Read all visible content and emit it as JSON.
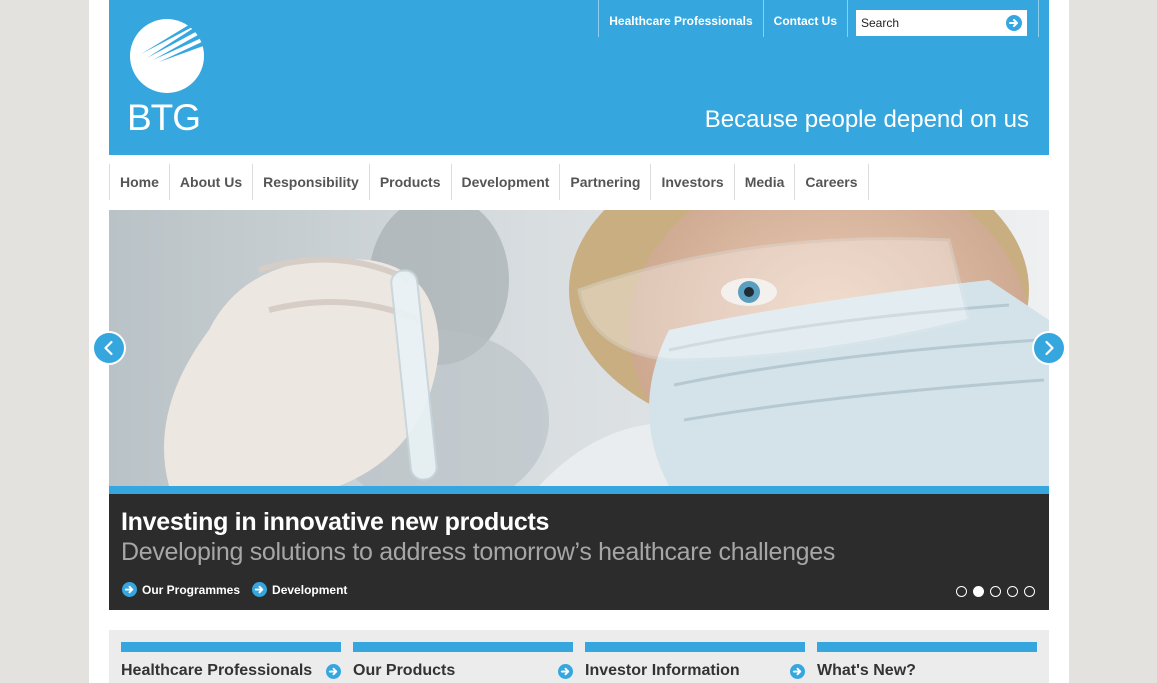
{
  "brand": {
    "logo_text": "BTG",
    "tagline": "Because people depend on us",
    "accent_color": "#36a7de"
  },
  "topnav": {
    "items": [
      "Healthcare Professionals",
      "Contact Us"
    ],
    "search_placeholder": "Search",
    "search_icon": "arrow-right-circle-icon"
  },
  "mainnav": {
    "items": [
      "Home",
      "About Us",
      "Responsibility",
      "Products",
      "Development",
      "Partnering",
      "Investors",
      "Media",
      "Careers"
    ]
  },
  "hero": {
    "image": "scientist-with-test-tube-photo",
    "title": "Investing in innovative new products",
    "subtitle": "Developing solutions to address tomorrow’s healthcare challenges",
    "links": [
      "Our Programmes",
      "Development"
    ],
    "slide_count": 5,
    "active_slide": 2,
    "prev_icon": "chevron-left-icon",
    "next_icon": "chevron-right-icon"
  },
  "boxes": [
    {
      "title": "Healthcare Professionals"
    },
    {
      "title": "Our Products"
    },
    {
      "title": "Investor Information"
    },
    {
      "title": "What's New?"
    }
  ]
}
